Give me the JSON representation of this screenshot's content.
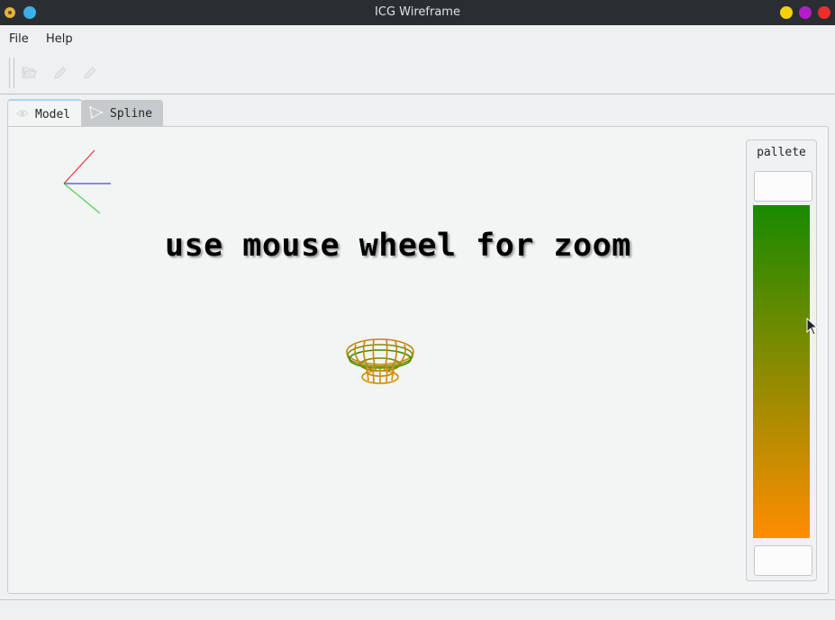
{
  "window": {
    "title": "ICG Wireframe"
  },
  "menu": {
    "file": "File",
    "help": "Help"
  },
  "toolbar": {
    "icons": [
      "open-folder-icon",
      "edit-icon",
      "edit-icon"
    ]
  },
  "tabs": [
    {
      "label": "Model",
      "icon": "eye-icon",
      "active": true
    },
    {
      "label": "Spline",
      "icon": "spline-icon",
      "active": false
    }
  ],
  "viewport": {
    "hint": "use mouse wheel for zoom",
    "axis_colors": {
      "x": "#4444ee",
      "y": "#ee2222",
      "z": "#22cc22"
    },
    "model_colors": [
      "#198a00",
      "#ff8c00"
    ]
  },
  "palette": {
    "title": "pallete",
    "top_value": "",
    "bottom_value": "",
    "gradient": {
      "start": "#198a00",
      "end": "#ff8c00"
    }
  }
}
